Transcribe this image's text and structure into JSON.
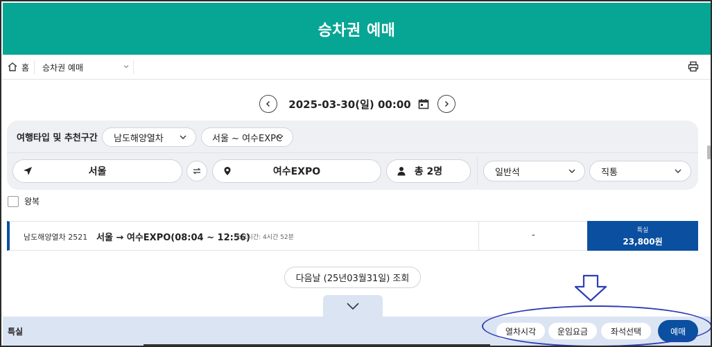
{
  "header": {
    "title": "승차권 예매"
  },
  "breadcrumb": {
    "home": "홈",
    "current": "승차권 예매"
  },
  "date": {
    "text": "2025-03-30(일) 00:00"
  },
  "search": {
    "title": "여행타입 및 추천구간",
    "travel_type": "남도해양열차",
    "route": "서울 ~ 여수EXPC",
    "departure": "서울",
    "arrival": "여수EXPO",
    "passengers": "총 2명",
    "seat_class": "일반석",
    "direct": "직통"
  },
  "roundtrip": {
    "label": "왕복"
  },
  "train": {
    "name": "남도해양열차 2521",
    "route": "서울 → 여수EXPO(08:04 ~ 12:56)",
    "duration": "소요시간: 4시간 52분",
    "general": "-",
    "fare_class": "특실",
    "fare_price": "23,800원"
  },
  "next_day": {
    "label": "다음날 (25년03월31일) 조회"
  },
  "bottom": {
    "label": "특실",
    "time_btn": "열차시각",
    "fare_btn": "운임요금",
    "seat_btn": "좌석선택",
    "book_btn": "예매"
  },
  "colors": {
    "header": "#07a594",
    "primary": "#0a4fa0",
    "annotation": "#2f3db5"
  }
}
